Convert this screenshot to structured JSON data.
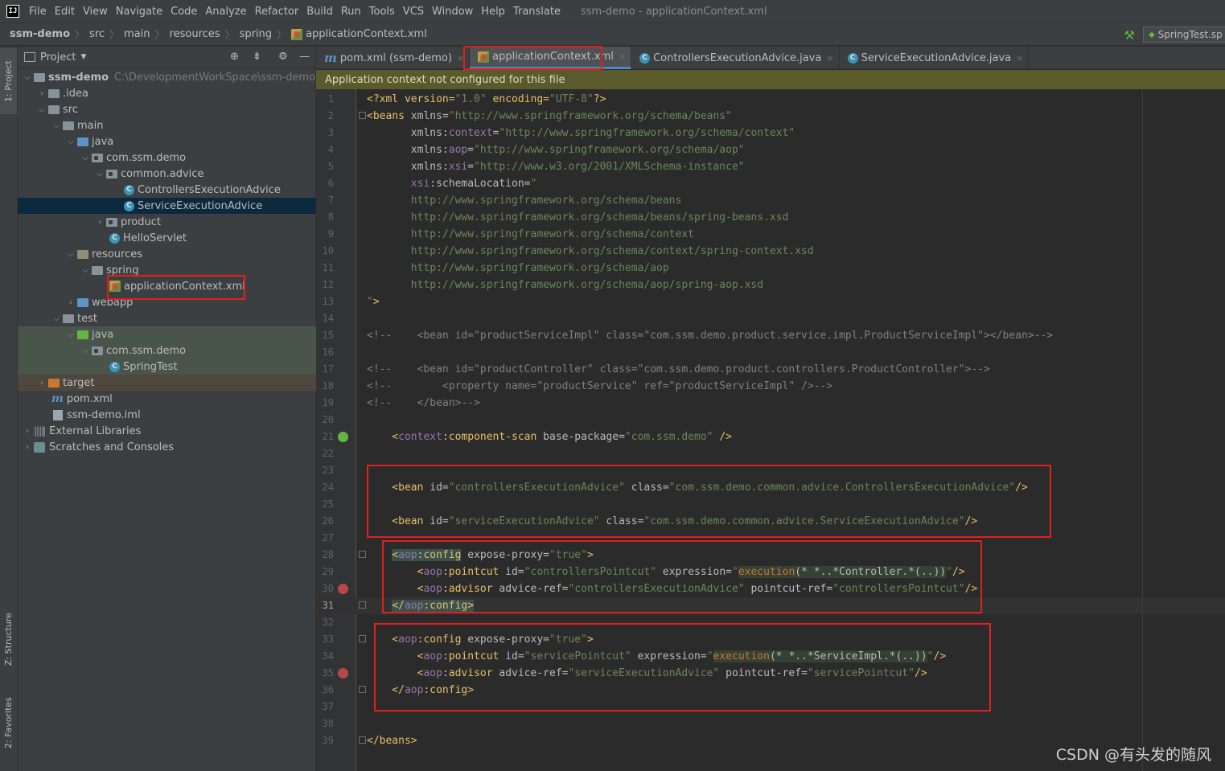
{
  "menu": {
    "items": [
      "File",
      "Edit",
      "View",
      "Navigate",
      "Code",
      "Analyze",
      "Refactor",
      "Build",
      "Run",
      "Tools",
      "VCS",
      "Window",
      "Help",
      "Translate"
    ],
    "window_title": "ssm-demo - applicationContext.xml"
  },
  "breadcrumb": [
    "ssm-demo",
    "src",
    "main",
    "resources",
    "spring",
    "applicationContext.xml"
  ],
  "run_config": "SpringTest.sp",
  "side_strip": {
    "project": "1: Project",
    "structure": "Z: Structure",
    "favorites": "2: Favorites"
  },
  "project_panel": {
    "title": "Project",
    "tree": [
      {
        "label": "ssm-demo",
        "path": "C:\\DevelopmentWorkSpace\\ssm-demo"
      },
      {
        "label": ".idea"
      },
      {
        "label": "src"
      },
      {
        "label": "main"
      },
      {
        "label": "java"
      },
      {
        "label": "com.ssm.demo"
      },
      {
        "label": "common.advice"
      },
      {
        "label": "ControllersExecutionAdvice"
      },
      {
        "label": "ServiceExecutionAdvice"
      },
      {
        "label": "product"
      },
      {
        "label": "HelloServlet"
      },
      {
        "label": "resources"
      },
      {
        "label": "spring"
      },
      {
        "label": "applicationContext.xml"
      },
      {
        "label": "webapp"
      },
      {
        "label": "test"
      },
      {
        "label": "java"
      },
      {
        "label": "com.ssm.demo"
      },
      {
        "label": "SpringTest"
      },
      {
        "label": "target"
      },
      {
        "label": "pom.xml"
      },
      {
        "label": "ssm-demo.iml"
      },
      {
        "label": "External Libraries"
      },
      {
        "label": "Scratches and Consoles"
      }
    ]
  },
  "editor_tabs": [
    {
      "label": "pom.xml (ssm-demo)"
    },
    {
      "label": "applicationContext.xml"
    },
    {
      "label": "ControllersExecutionAdvice.java"
    },
    {
      "label": "ServiceExecutionAdvice.java"
    }
  ],
  "notice": "Application context not configured for this file",
  "code": {
    "current_line": 31,
    "line_numbers": [
      "1",
      "2",
      "3",
      "4",
      "5",
      "6",
      "7",
      "8",
      "9",
      "10",
      "11",
      "12",
      "13",
      "14",
      "15",
      "16",
      "17",
      "18",
      "19",
      "20",
      "21",
      "22",
      "23",
      "24",
      "25",
      "26",
      "27",
      "28",
      "29",
      "30",
      "31",
      "32",
      "33",
      "34",
      "35",
      "36",
      "37",
      "38",
      "39"
    ],
    "t": {
      "l1a": "<?xml version=",
      "l1b": "\"1.0\"",
      "l1c": " encoding=",
      "l1d": "\"UTF-8\"",
      "l1e": "?>",
      "l2a": "<beans",
      "l2b": " xmlns=",
      "l2c": "\"http://www.springframework.org/schema/beans\"",
      "l3a": "       xmlns:",
      "l3b": "context",
      "l3c": "=",
      "l3d": "\"http://www.springframework.org/schema/context\"",
      "l4a": "       xmlns:",
      "l4b": "aop",
      "l4c": "=",
      "l4d": "\"http://www.springframework.org/schema/aop\"",
      "l5a": "       xmlns:",
      "l5b": "xsi",
      "l5c": "=",
      "l5d": "\"http://www.w3.org/2001/XMLSchema-instance\"",
      "l6a": "       ",
      "l6b": "xsi",
      "l6c": ":schemaLocation=",
      "l6d": "\"",
      "l7": "       http://www.springframework.org/schema/beans",
      "l8": "       http://www.springframework.org/schema/beans/spring-beans.xsd",
      "l9": "       http://www.springframework.org/schema/context",
      "l10": "       http://www.springframework.org/schema/context/spring-context.xsd",
      "l11": "       http://www.springframework.org/schema/aop",
      "l12": "       http://www.springframework.org/schema/aop/spring-aop.xsd",
      "l13a": "\"",
      "l13b": ">",
      "l15": "<!--    <bean id=\"productServiceImpl\" class=\"com.ssm.demo.product.service.impl.ProductServiceImpl\"></bean>-->",
      "l17": "<!--    <bean id=\"productController\" class=\"com.ssm.demo.product.controllers.ProductController\">-->",
      "l18": "<!--        <property name=\"productService\" ref=\"productServiceImpl\" />-->",
      "l19": "<!--    </bean>-->",
      "l21a": "    <",
      "l21b": "context",
      "l21c": ":component-scan",
      "l21d": " base-package=",
      "l21e": "\"com.ssm.demo\"",
      "l21f": " />",
      "l24a": "    <bean",
      "l24b": " id=",
      "l24c": "\"controllersExecutionAdvice\"",
      "l24d": " class=",
      "l24e": "\"com.ssm.demo.common.advice.ControllersExecutionAdvice\"",
      "l24f": "/>",
      "l26a": "    <bean",
      "l26b": " id=",
      "l26c": "\"serviceExecutionAdvice\"",
      "l26d": " class=",
      "l26e": "\"com.ssm.demo.common.advice.ServiceExecutionAdvice\"",
      "l26f": "/>",
      "l28a": "    ",
      "l28b": "<",
      "l28c": "aop",
      "l28d": ":config",
      "l28e": " expose-proxy=",
      "l28f": "\"true\"",
      "l28g": ">",
      "l29a": "        <",
      "l29b": "aop",
      "l29c": ":pointcut",
      "l29d": " id=",
      "l29e": "\"controllersPointcut\"",
      "l29f": " expression=",
      "l29g": "\"",
      "l29h": "execution",
      "l29i": "(* *..*Controller.*(..))",
      "l29j": "\"",
      "l29k": "/>",
      "l30a": "        <",
      "l30b": "aop",
      "l30c": ":advisor",
      "l30d": " advice-ref=",
      "l30e": "\"controllersExecutionAdvice\"",
      "l30f": " pointcut-ref=",
      "l30g": "\"controllersPointcut\"",
      "l30h": "/>",
      "l31a": "    ",
      "l31b": "</",
      "l31c": "aop",
      "l31d": ":config",
      "l31e": ">",
      "l33a": "    <",
      "l33b": "aop",
      "l33c": ":config",
      "l33d": " expose-proxy=",
      "l33e": "\"true\"",
      "l33f": ">",
      "l34a": "        <",
      "l34b": "aop",
      "l34c": ":pointcut",
      "l34d": " id=",
      "l34e": "\"servicePointcut\"",
      "l34f": " expression=",
      "l34g": "\"",
      "l34h": "execution",
      "l34i": "(* *..*ServiceImpl.*(..))",
      "l34j": "\"",
      "l34k": "/>",
      "l35a": "        <",
      "l35b": "aop",
      "l35c": ":advisor",
      "l35d": " advice-ref=",
      "l35e": "\"serviceExecutionAdvice\"",
      "l35f": " pointcut-ref=",
      "l35g": "\"servicePointcut\"",
      "l35h": "/>",
      "l36a": "    </",
      "l36b": "aop",
      "l36c": ":config",
      "l36d": ">",
      "l39": "</beans>"
    }
  },
  "watermark": "CSDN @有头发的随风",
  "colors": {
    "annotation_red": "#e02020",
    "selection": "#0d293e",
    "notice_bg": "#5a5a2c"
  }
}
